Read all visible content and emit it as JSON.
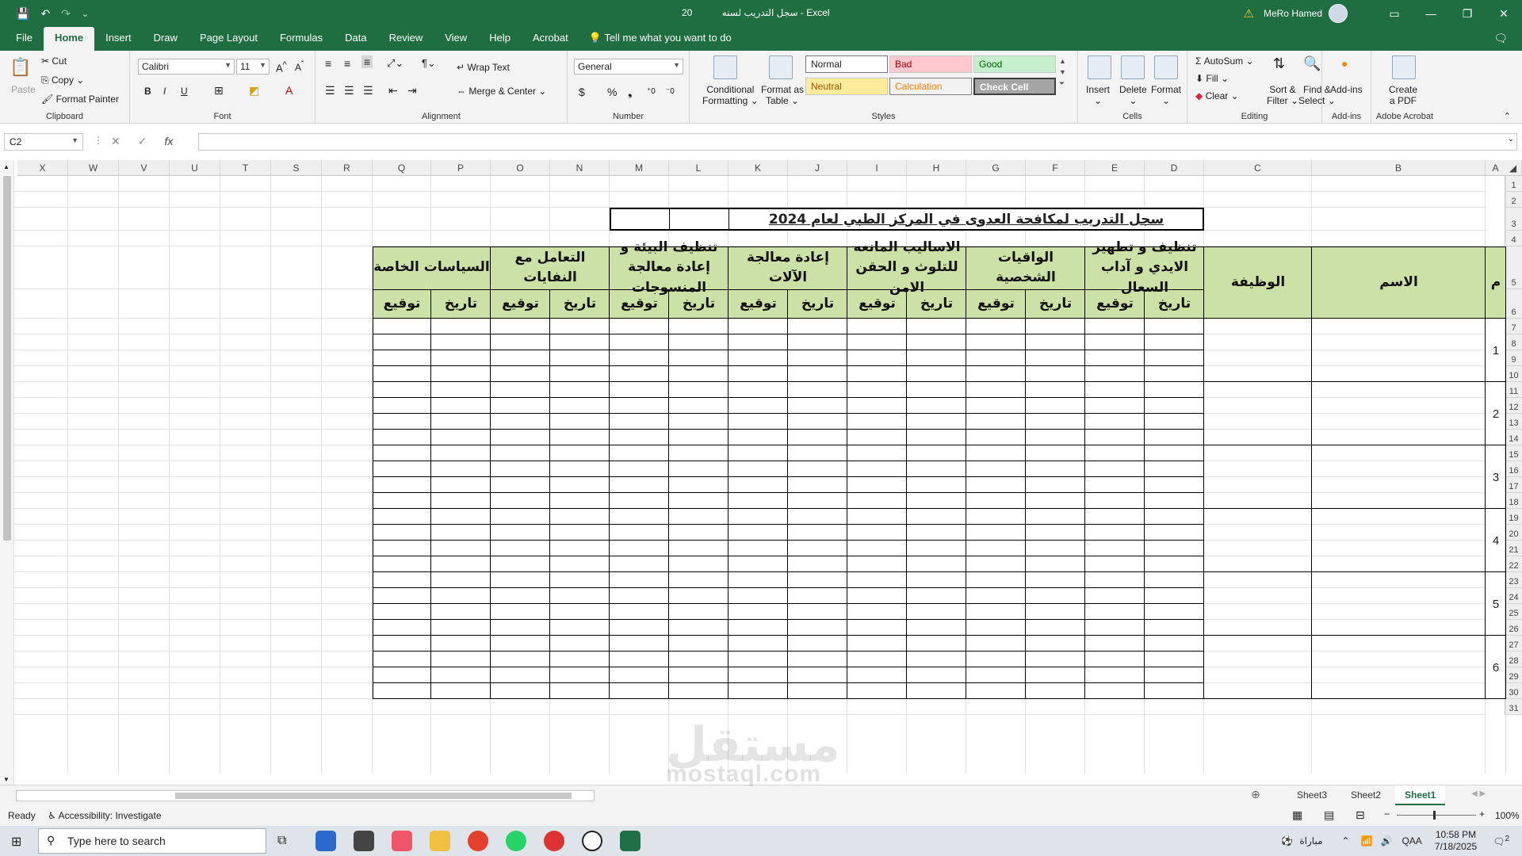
{
  "titlebar": {
    "doc_name": "سجل التدريب لسنه",
    "doc_year": "20",
    "separator": "-",
    "app": "Excel",
    "user": "MeRo Hamed"
  },
  "tabs": [
    "File",
    "Home",
    "Insert",
    "Draw",
    "Page Layout",
    "Formulas",
    "Data",
    "Review",
    "View",
    "Help",
    "Acrobat"
  ],
  "tell_me": "Tell me what you want to do",
  "ribbon": {
    "clipboard": {
      "paste": "Paste",
      "cut": "Cut",
      "copy": "Copy",
      "format_painter": "Format Painter",
      "label": "Clipboard"
    },
    "font": {
      "name": "Calibri",
      "size": "11",
      "label": "Font",
      "bold": "B",
      "italic": "I",
      "underline": "U"
    },
    "alignment": {
      "wrap": "Wrap Text",
      "merge": "Merge & Center",
      "label": "Alignment"
    },
    "number": {
      "format": "General",
      "currency": "$",
      "percent": "%",
      "comma": "❟",
      "label": "Number"
    },
    "styles": {
      "conditional": "Conditional",
      "conditional2": "Formatting",
      "format_as": "Format as",
      "format_as2": "Table",
      "normal": "Normal",
      "bad": "Bad",
      "good": "Good",
      "neutral": "Neutral",
      "calculation": "Calculation",
      "check_cell": "Check Cell",
      "label": "Styles"
    },
    "cells": {
      "insert": "Insert",
      "delete": "Delete",
      "format": "Format",
      "label": "Cells"
    },
    "editing": {
      "autosum": "AutoSum",
      "fill": "Fill",
      "clear": "Clear",
      "sort": "Sort &",
      "sort2": "Filter",
      "find": "Find &",
      "find2": "Select",
      "label": "Editing"
    },
    "addins": {
      "addins": "Add-ins",
      "label": "Add-ins"
    },
    "acrobat": {
      "create": "Create",
      "create2": "a PDF",
      "label": "Adobe Acrobat"
    }
  },
  "formula_bar": {
    "cell_ref": "C2",
    "fx": "fx",
    "value": ""
  },
  "columns": [
    "X",
    "W",
    "V",
    "U",
    "T",
    "S",
    "R",
    "Q",
    "P",
    "O",
    "N",
    "M",
    "L",
    "K",
    "J",
    "I",
    "H",
    "G",
    "F",
    "E",
    "D",
    "C",
    "B",
    "A"
  ],
  "rows": [
    "1",
    "2",
    "3",
    "4",
    "5",
    "6",
    "7",
    "8",
    "9",
    "10",
    "11",
    "12",
    "13",
    "14",
    "15",
    "16",
    "17",
    "18",
    "19",
    "20",
    "21",
    "22",
    "23",
    "24",
    "25",
    "26",
    "27",
    "28",
    "29",
    "30",
    "31"
  ],
  "sheet": {
    "title": "سجل التدريب لمكافحة العدوى في المركز الطبي لعام 2024",
    "header_m": "م",
    "header_name": "الاسم",
    "header_job": "الوظيفة",
    "groups": [
      "تنظيف و تطهير الايدي و آداب السعال",
      "الواقيات الشخصية",
      "الاساليب المانعه للتلوث و الحقن الامن",
      "إعادة معالجة الآلات",
      "تنظيف البيئة و إعادة معالجة المنسوجات",
      "التعامل مع النفايات",
      "السياسات الخاصة"
    ],
    "sub_date": "تاريخ",
    "sub_sign": "توقيع",
    "numbers": [
      "1",
      "2",
      "3",
      "4",
      "5",
      "6"
    ]
  },
  "sheet_tabs": [
    "Sheet3",
    "Sheet2",
    "Sheet1"
  ],
  "status": {
    "ready": "Ready",
    "accessibility": "Accessibility: Investigate",
    "zoom": "100%"
  },
  "taskbar": {
    "search": "Type here to search",
    "weather": "مباراة",
    "lang": "QAA",
    "time": "10:58 PM",
    "date": "7/18/2025",
    "notif": "2"
  },
  "watermark": {
    "ar": "مستقل",
    "en": "mostaql.com"
  }
}
